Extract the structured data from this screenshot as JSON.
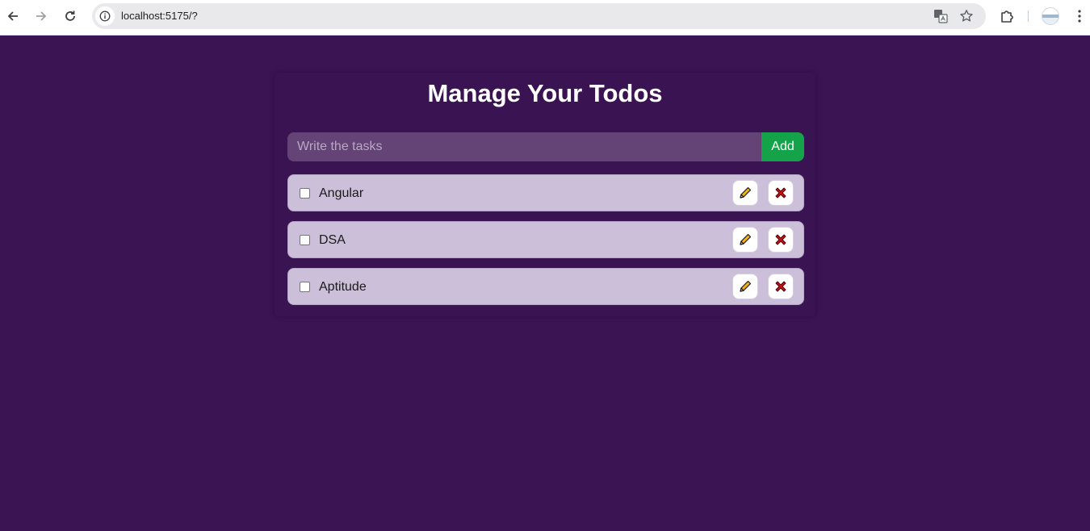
{
  "browser": {
    "url": "localhost:5175/?",
    "icons": [
      "back-icon",
      "forward-icon",
      "reload-icon",
      "site-info-icon",
      "translate-icon",
      "bookmark-star-icon",
      "extensions-icon",
      "profile-avatar",
      "menu-kebab-icon"
    ]
  },
  "app": {
    "title": "Manage Your Todos",
    "input": {
      "placeholder": "Write the tasks",
      "value": ""
    },
    "add_label": "Add",
    "todos": [
      {
        "text": "Angular",
        "completed": false
      },
      {
        "text": "DSA",
        "completed": false
      },
      {
        "text": "Aptitude",
        "completed": false
      }
    ],
    "item_icons": {
      "edit": "pencil-icon",
      "delete": "close-x-icon"
    },
    "colors": {
      "page_background": "#3b1453",
      "input_background": "#644476",
      "add_button": "#15a34a",
      "todo_background": "#ccbfd9",
      "delete_icon": "#c0161b",
      "edit_icon": "#f0b21a"
    }
  }
}
